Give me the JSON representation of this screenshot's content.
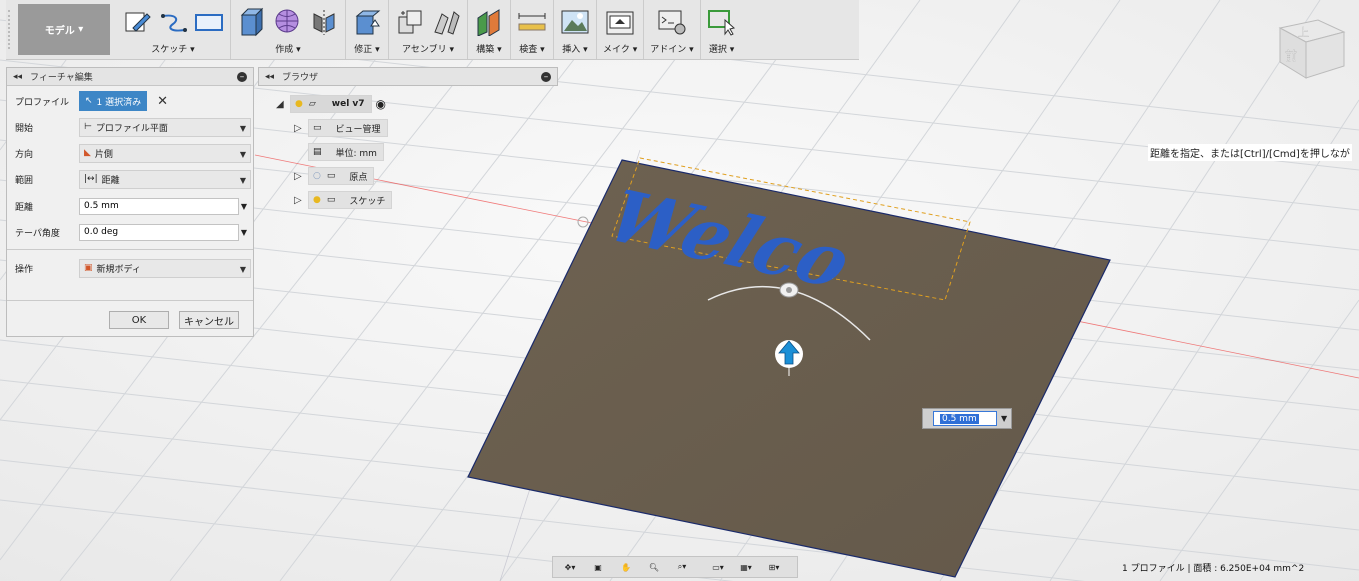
{
  "toolbar": {
    "workspace": "モデル",
    "groups": [
      {
        "label": "スケッチ"
      },
      {
        "label": "作成"
      },
      {
        "label": "修正"
      },
      {
        "label": "アセンブリ"
      },
      {
        "label": "構築"
      },
      {
        "label": "検査"
      },
      {
        "label": "挿入"
      },
      {
        "label": "メイク"
      },
      {
        "label": "アドイン"
      },
      {
        "label": "選択"
      }
    ]
  },
  "feature_panel": {
    "title": "フィーチャ編集",
    "profile": {
      "label": "プロファイル",
      "value": "1 選択済み"
    },
    "start": {
      "label": "開始",
      "value": "プロファイル平面"
    },
    "direction": {
      "label": "方向",
      "value": "片側"
    },
    "extent": {
      "label": "範囲",
      "value": "距離"
    },
    "distance": {
      "label": "距離",
      "value": "0.5 mm"
    },
    "taper": {
      "label": "テーパ角度",
      "value": "0.0 deg"
    },
    "operation": {
      "label": "操作",
      "value": "新規ボディ"
    },
    "ok": "OK",
    "cancel": "キャンセル"
  },
  "browser": {
    "title": "ブラウザ",
    "root": "wel v7",
    "items": [
      {
        "label": "ビュー管理"
      },
      {
        "label": "単位: mm"
      },
      {
        "label": "原点"
      },
      {
        "label": "スケッチ"
      }
    ]
  },
  "canvas": {
    "sketch_text": "Welco",
    "dimension_value": "0.5 mm",
    "hint": "距離を指定、または[Ctrl]/[Cmd]を押しなが",
    "viewcube_top": "上",
    "viewcube_front": "前",
    "colors": {
      "plate": "#6b5f4d",
      "sketch_text": "#2c5fc6",
      "arrow": "#1b8fd6"
    }
  },
  "status": "1 プロファイル | 面積 : 6.250E+04 mm^2"
}
